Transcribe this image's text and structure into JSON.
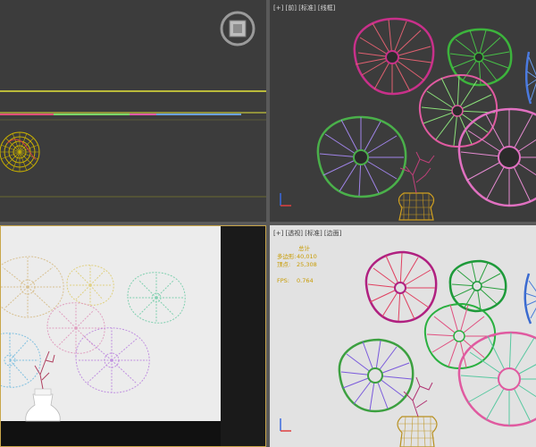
{
  "viewports": {
    "top": {
      "label": ""
    },
    "front": {
      "label": "[+] [前] [标准] [线框]"
    },
    "left": {
      "label": "]"
    },
    "perspective": {
      "label": "[+] [透视] [标准] [边面]",
      "stats": {
        "title": "总计",
        "polys_label": "多边形:",
        "polys_value": "40,010",
        "verts_label": "顶点:",
        "verts_value": "25,308",
        "fps_label": "FPS:",
        "fps_value": "0.764"
      }
    }
  },
  "colors": {
    "viewport_dark": "#3c3c3c",
    "viewport_light": "#e2e2e2",
    "active_border": "#c9a64a",
    "separator": "#5a5a5a"
  },
  "icons": [
    "viewcube-icon",
    "axis-gizmo-icon"
  ]
}
